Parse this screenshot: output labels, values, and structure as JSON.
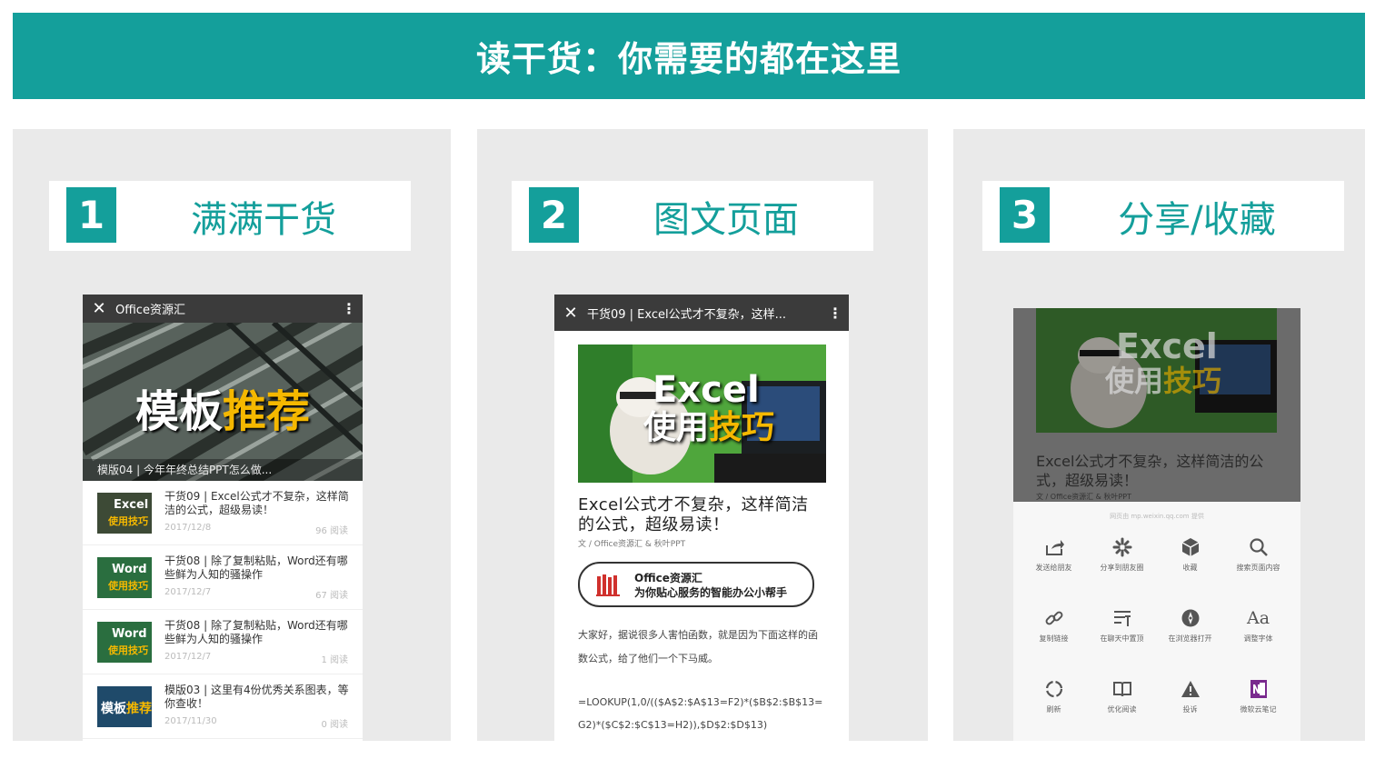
{
  "banner": {
    "title": "读干货：你需要的都在这里"
  },
  "panels": [
    {
      "num": "1",
      "title": "满满干货"
    },
    {
      "num": "2",
      "title": "图文页面"
    },
    {
      "num": "3",
      "title": "分享/收藏"
    }
  ],
  "phone1": {
    "app_title": "Office资源汇",
    "hero": {
      "text_white": "模板",
      "text_yellow": "推荐",
      "caption": "模版04 | 今年年终总结PPT怎么做..."
    },
    "articles": [
      {
        "title": "干货09 | Excel公式才不复杂，这样简洁的公式，超级易读！",
        "date": "2017/12/8",
        "reads": "96 阅读",
        "thumb_a": "Excel",
        "thumb_b": "使用技巧"
      },
      {
        "title": "干货08 | 除了复制粘贴，Word还有哪些鲜为人知的骚操作",
        "date": "2017/12/7",
        "reads": "67 阅读",
        "thumb_a": "Word",
        "thumb_b": "使用技巧"
      },
      {
        "title": "干货08 | 除了复制粘贴，Word还有哪些鲜为人知的骚操作",
        "date": "2017/12/7",
        "reads": "1 阅读",
        "thumb_a": "Word",
        "thumb_b": "使用技巧"
      },
      {
        "title": "模版03 | 这里有4份优秀关系图表，等你查收！",
        "date": "2017/11/30",
        "reads": "0 阅读",
        "thumb_a": "模板",
        "thumb_b": "推荐"
      }
    ]
  },
  "phone2": {
    "app_title": "干货09 | Excel公式才不复杂，这样...",
    "hero": {
      "text_a": "Excel",
      "text_b": "使用",
      "text_c": "技巧"
    },
    "article_title": "Excel公式才不复杂，这样简洁的公式，超级易读！",
    "byline": "文 / Office资源汇 & 秋叶PPT",
    "card": {
      "line1": "Office资源汇",
      "line2": "为你贴心服务的智能办公小帮手"
    },
    "paragraph": "大家好，据说很多人害怕函数，就是因为下面这样的函数公式，给了他们一个下马威。",
    "formula": "=LOOKUP(1,0/(($A$2:$A$13=F2)*($B$2:$B$13=G2)*($C$2:$C$13=H2)),$D$2:$D$13)"
  },
  "phone3": {
    "hero": {
      "text_a": "Excel",
      "text_b": "使用",
      "text_c": "技巧"
    },
    "article_title": "Excel公式才不复杂，这样简洁的公式，超级易读！",
    "byline": "文 / Office资源汇 & 秋叶PPT",
    "source_note": "网页由 mp.weixin.qq.com 提供",
    "actions": [
      {
        "label": "发送给朋友",
        "icon": "share-forward-icon"
      },
      {
        "label": "分享到朋友圈",
        "icon": "moments-icon"
      },
      {
        "label": "收藏",
        "icon": "favorite-cube-icon"
      },
      {
        "label": "搜索页面内容",
        "icon": "search-icon"
      },
      {
        "label": "复制链接",
        "icon": "link-icon"
      },
      {
        "label": "在聊天中置顶",
        "icon": "pin-chat-icon"
      },
      {
        "label": "在浏览器打开",
        "icon": "browser-icon"
      },
      {
        "label": "调整字体",
        "icon": "font-size-icon"
      },
      {
        "label": "刷新",
        "icon": "refresh-icon"
      },
      {
        "label": "优化阅读",
        "icon": "reader-mode-icon"
      },
      {
        "label": "投诉",
        "icon": "complaint-icon"
      },
      {
        "label": "微软云笔记",
        "icon": "onenote-icon"
      }
    ]
  },
  "colors": {
    "accent": "#149f9b",
    "panel_bg": "#eaeaea",
    "appbar": "#3b3b3b",
    "highlight": "#f5b800"
  }
}
